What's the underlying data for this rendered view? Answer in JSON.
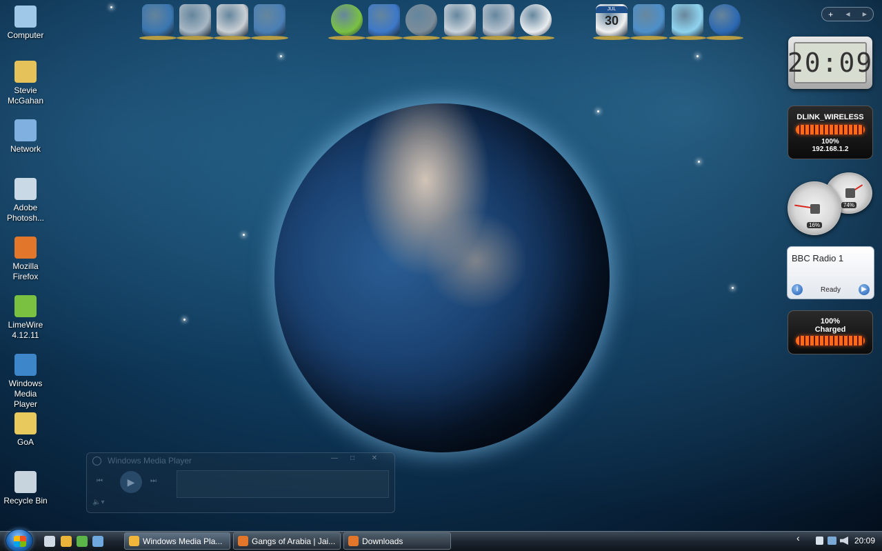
{
  "desktop_icons": [
    {
      "label": "Computer",
      "icon": "computer-icon",
      "color": "#9fc7e8"
    },
    {
      "label": "Stevie McGahan",
      "icon": "user-folder-icon",
      "color": "#e6c25a"
    },
    {
      "label": "Network",
      "icon": "network-icon",
      "color": "#7fb0e0"
    },
    {
      "label": "Adobe Photosh...",
      "icon": "photoshop-icon",
      "color": "#c9d9e6"
    },
    {
      "label": "Mozilla Firefox",
      "icon": "firefox-icon",
      "color": "#e2762b"
    },
    {
      "label": "LimeWire 4.12.11",
      "icon": "limewire-icon",
      "color": "#7ac142"
    },
    {
      "label": "Windows Media Player",
      "icon": "media-player-icon",
      "color": "#3d86c9"
    },
    {
      "label": "GoA",
      "icon": "folder-icon",
      "color": "#e8c95d"
    },
    {
      "label": "Recycle Bin",
      "icon": "recycle-bin-icon",
      "color": "#c8d4dd"
    }
  ],
  "dock": {
    "items": [
      {
        "name": "media-center-icon",
        "color": "#3a76b0"
      },
      {
        "name": "documents-icon",
        "color": "#a7b7c4"
      },
      {
        "name": "pictures-icon",
        "color": "#c9cfd4"
      },
      {
        "name": "music-icon",
        "color": "#4a7fb5"
      },
      {
        "name": "limewire-icon",
        "color": "#7ac142"
      },
      {
        "name": "notes-icon",
        "color": "#3d78c8"
      },
      {
        "name": "internet-icon",
        "color": "#7a8c9a"
      },
      {
        "name": "mail-icon",
        "color": "#c8d2da"
      },
      {
        "name": "media-icon",
        "color": "#b7c3cf"
      },
      {
        "name": "skype-icon",
        "color": "#e8ecef"
      },
      {
        "name": "calendar-icon",
        "color": "#f1f1f1",
        "text": "30",
        "month": "JUL"
      },
      {
        "name": "settings-icon",
        "color": "#4d8fc9"
      },
      {
        "name": "ice-cube-icon",
        "color": "#8fd3ef"
      },
      {
        "name": "windows-logo-icon",
        "color": "#2b68b2"
      }
    ],
    "add_label": "+",
    "prev_label": "◀",
    "next_label": "▶"
  },
  "gadgets": {
    "clock": {
      "time": "20:09"
    },
    "wifi": {
      "ssid": "DLINK_WIRELESS",
      "signal": "100%",
      "ip": "192.168.1.2"
    },
    "cpu": {
      "cpu_label": "16%",
      "mem_label": "74%",
      "cpu_value": 16,
      "mem_value": 74
    },
    "radio": {
      "station": "BBC Radio 1",
      "status": "Ready",
      "info_label": "i",
      "play_label": "▶"
    },
    "battery": {
      "percent": "100%",
      "state": "Charged",
      "level": 1.0
    }
  },
  "wmp_window": {
    "title": "Windows Media Player",
    "minimize": "—",
    "maximize": "□",
    "close": "✕",
    "prev": "⏮",
    "play": "▶",
    "next": "⏭",
    "volume": "🔈▾"
  },
  "taskbar": {
    "quick_launch": [
      {
        "name": "show-desktop-icon",
        "color": "#cfd9e3"
      },
      {
        "name": "wmp-quicklaunch-icon",
        "color": "#e8b43a"
      },
      {
        "name": "messenger-icon",
        "color": "#5bb548"
      },
      {
        "name": "switch-windows-icon",
        "color": "#6fa8dc"
      }
    ],
    "tasks": [
      {
        "label": "Windows Media Pla...",
        "icon": "media-player-icon",
        "color": "#f0b63c",
        "active": true
      },
      {
        "label": "Gangs of Arabia | Jai...",
        "icon": "firefox-icon",
        "color": "#e2762b",
        "active": false
      },
      {
        "label": "Downloads",
        "icon": "firefox-icon",
        "color": "#e2762b",
        "active": false
      }
    ],
    "tray": {
      "chevron": "‹",
      "time": "20:09"
    }
  }
}
